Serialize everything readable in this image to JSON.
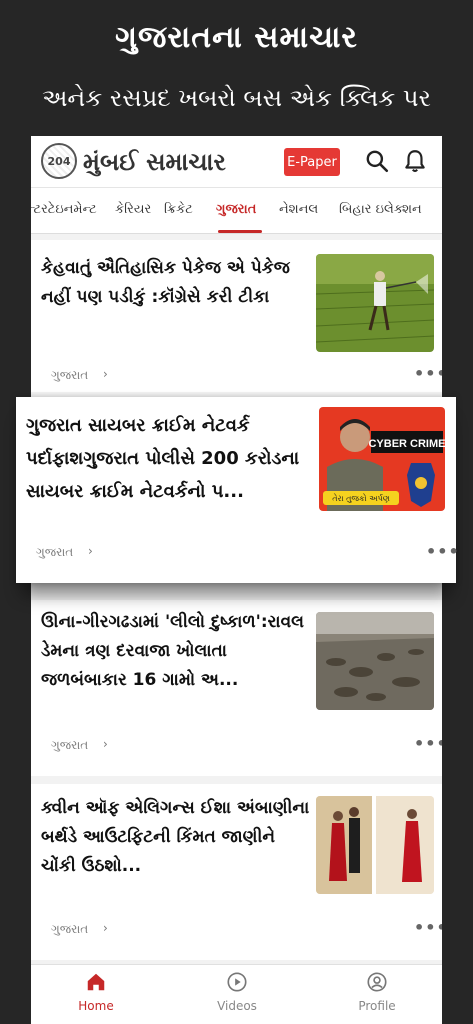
{
  "promo": {
    "title": "ગુજરાતના સમાચાર",
    "subtitle": "અનેક રસપ્રદ ખબરો બસ એક ક્લિક પર"
  },
  "header": {
    "logo_seal": "204",
    "logo_text": "મુંબઈ સમાચાર",
    "epaper_label": "E-Paper",
    "accent_color": "#e53935"
  },
  "categories": [
    {
      "label": "ન્ટરટેઇનમેન્ટ",
      "active": false
    },
    {
      "label": "કેરિયર",
      "active": false
    },
    {
      "label": "ક્રિકેટ",
      "active": false
    },
    {
      "label": "ગુજરાત",
      "active": true
    },
    {
      "label": "નેશનલ",
      "active": false
    },
    {
      "label": "બિહાર ઇલેક્શન",
      "active": false
    }
  ],
  "articles": [
    {
      "title": "કેહવાતું ઐતિહાસિક પેકેજ એ પેકેજ નહીં પણ પડીકું :કૉંગ્રેસે કરી ટીકા",
      "category": "ગુજરાત",
      "more": "•••",
      "image": "farmer-spraying-field"
    },
    {
      "title": "ગુજરાત સાયબર ક્રાઈમ નેટવર્ક પર્દાફાશગુજરાત પોલીસે 200 કરોડના સાયબર ક્રાઈમ નેટવર્કનો પ...",
      "category": "ગુજરાત",
      "more": "•••",
      "image": "cyber-crime-banner",
      "image_text": "CYBER CRIME",
      "image_caption": "તેરા તુજકો અર્પણ"
    },
    {
      "title": "ઊના-ગીરગઢડામાં 'લીલો દુષ્કાળ':રાવલ ડેમના ત્રણ દરવાજા ખોલાતા જળબંબાકાર 16 ગામો અ...",
      "category": "ગુજરાત",
      "more": "•••",
      "image": "flooded-field"
    },
    {
      "title": "ક્વીન ઑફ એલિગન્સ ઈશા અંબાણીના બર્થડે આઉટફિટની કિંમત જાણીને ચોંકી ઉઠશો...",
      "category": "ગુજરાત",
      "more": "•••",
      "image": "couple-red-outfits"
    }
  ],
  "bottom_nav": [
    {
      "label": "Home",
      "icon": "home-icon",
      "active": true
    },
    {
      "label": "Videos",
      "icon": "play-icon",
      "active": false
    },
    {
      "label": "Profile",
      "icon": "profile-icon",
      "active": false
    }
  ]
}
